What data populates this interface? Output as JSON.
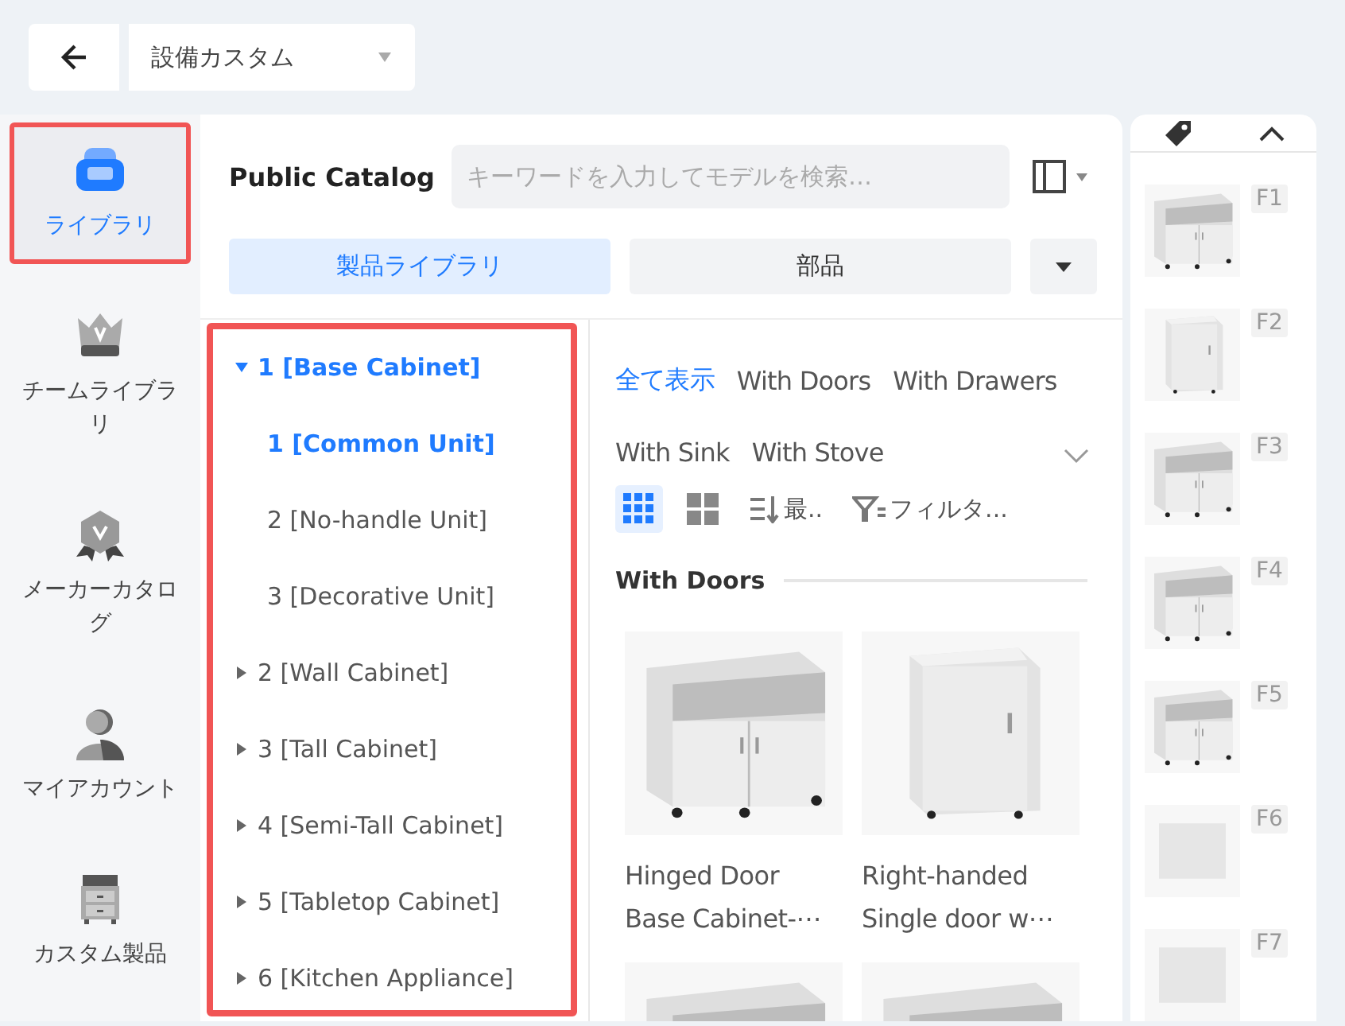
{
  "top_bar": {
    "project": "設備カスタム"
  },
  "nav": [
    {
      "kind": "sofa",
      "label": "ライブラリ",
      "selected": true,
      "highlighted": true
    },
    {
      "kind": "crown",
      "label": "チームライブラリ",
      "selected": false,
      "highlighted": false
    },
    {
      "kind": "medal",
      "label": "メーカーカタログ",
      "selected": false,
      "highlighted": false
    },
    {
      "kind": "person",
      "label": "マイアカウント",
      "selected": false,
      "highlighted": false
    },
    {
      "kind": "cabinet",
      "label": "カスタム製品",
      "selected": false,
      "highlighted": false
    }
  ],
  "catalog": {
    "title": "Public Catalog",
    "search": {
      "placeholder": "キーワードを入力してモデルを検索…"
    },
    "tabs": [
      {
        "label": "製品ライブラリ",
        "selected": true
      },
      {
        "label": "部品",
        "selected": false
      }
    ],
    "tree": {
      "highlighted": true,
      "items": [
        {
          "label": "1 [Base Cabinet]",
          "expanded": true,
          "children": [
            {
              "label": "1 [Common Unit]",
              "selected": true
            },
            {
              "label": "2 [No-handle Unit]",
              "selected": false
            },
            {
              "label": "3 [Decorative Unit]",
              "selected": false
            }
          ]
        },
        {
          "label": "2 [Wall Cabinet]",
          "expanded": false
        },
        {
          "label": "3 [Tall Cabinet]",
          "expanded": false
        },
        {
          "label": "4 [Semi-Tall Cabinet]",
          "expanded": false
        },
        {
          "label": "5 [Tabletop Cabinet]",
          "expanded": false
        },
        {
          "label": "6 [Kitchen Appliance]",
          "expanded": false
        }
      ]
    },
    "filters": [
      {
        "label": "全て表示",
        "selected": true
      },
      {
        "label": "With Doors",
        "selected": false
      },
      {
        "label": "With Drawers",
        "selected": false
      },
      {
        "label": "With Sink",
        "selected": false
      },
      {
        "label": "With Stove",
        "selected": false
      }
    ],
    "views": [
      {
        "kind": "small-grid",
        "selected": true
      },
      {
        "kind": "large-grid",
        "selected": false
      }
    ],
    "sort": "最..",
    "filter": "フィルタ...",
    "section": "With Doors",
    "products": [
      {
        "kind": "open-top",
        "name": "Hinged Door Base Cabinet-⋯"
      },
      {
        "kind": "single",
        "name": "Right-handed Single door w⋯"
      },
      {
        "kind": "open-top"
      },
      {
        "kind": "open-top"
      }
    ]
  },
  "side_list": [
    {
      "label": "F1"
    },
    {
      "label": "F2"
    },
    {
      "label": "F3"
    },
    {
      "label": "F4"
    },
    {
      "label": "F5"
    },
    {
      "label": "F6"
    },
    {
      "label": "F7"
    }
  ]
}
